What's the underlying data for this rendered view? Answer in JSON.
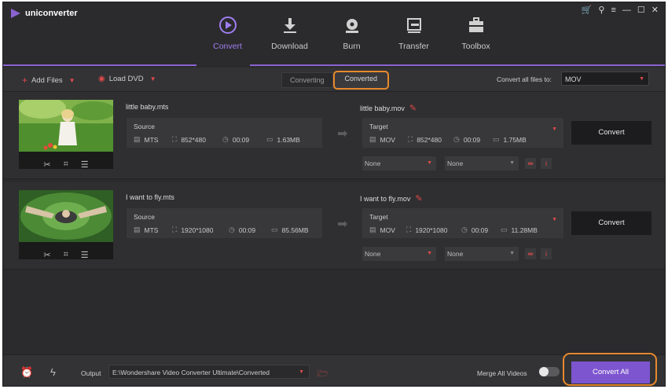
{
  "app": {
    "name": "uniconverter"
  },
  "window_controls": [
    "🛒",
    "⚲",
    "≡",
    "—",
    "☐",
    "✕"
  ],
  "nav": {
    "tabs": [
      {
        "label": "Convert",
        "icon": "convert-icon",
        "active": true
      },
      {
        "label": "Download",
        "icon": "download-icon",
        "active": false
      },
      {
        "label": "Burn",
        "icon": "burn-icon",
        "active": false
      },
      {
        "label": "Transfer",
        "icon": "transfer-icon",
        "active": false
      },
      {
        "label": "Toolbox",
        "icon": "toolbox-icon",
        "active": false
      }
    ]
  },
  "toolbar": {
    "add_files": "Add Files",
    "load_dvd": "Load DVD",
    "segments": {
      "converting": "Converting",
      "converted": "Converted"
    },
    "convert_all_label": "Convert all files to:",
    "format": "MOV"
  },
  "files": [
    {
      "source_name": "little baby.mts",
      "target_name": "little baby.mov",
      "source": {
        "label": "Source",
        "format": "MTS",
        "resolution": "852*480",
        "duration": "00:09",
        "size": "1.63MB"
      },
      "target": {
        "label": "Target",
        "format": "MOV",
        "resolution": "852*480",
        "duration": "00:09",
        "size": "1.75MB"
      },
      "subtitle": "None",
      "audio": "None",
      "convert_label": "Convert"
    },
    {
      "source_name": "I want to fly.mts",
      "target_name": "I want to fly.mov",
      "source": {
        "label": "Source",
        "format": "MTS",
        "resolution": "1920*1080",
        "duration": "00:09",
        "size": "85.56MB"
      },
      "target": {
        "label": "Target",
        "format": "MOV",
        "resolution": "1920*1080",
        "duration": "00:09",
        "size": "11.28MB"
      },
      "subtitle": "None",
      "audio": "None",
      "convert_label": "Convert"
    }
  ],
  "bottom": {
    "output_label": "Output",
    "output_path": "E:\\Wondershare Video Converter Ultimate\\Converted",
    "merge_label": "Merge All Videos",
    "convert_all": "Convert All"
  },
  "colors": {
    "accent": "#8a63d2",
    "highlight": "#e8892e",
    "icon_red": "#e24a4a"
  }
}
